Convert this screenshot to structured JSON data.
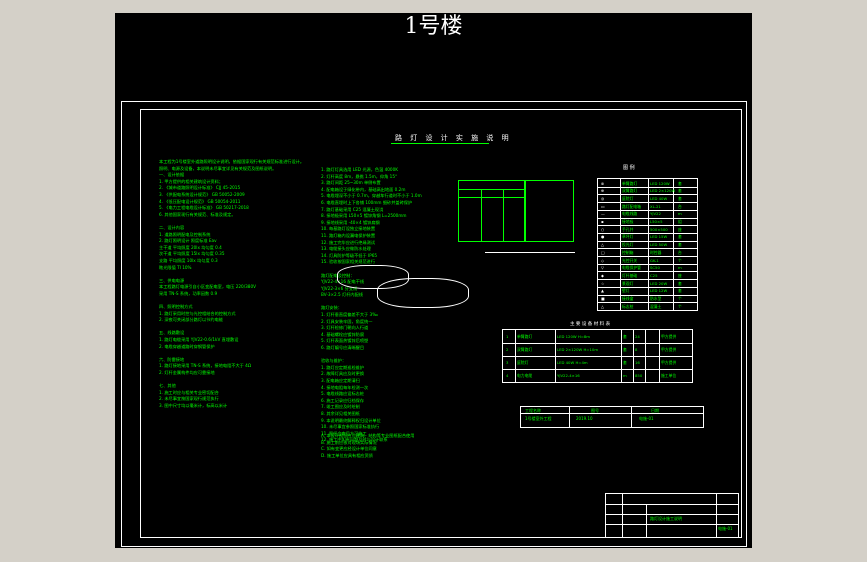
{
  "page_title": "1号楼",
  "heading": "路 灯 设 计 实 施 说 明",
  "col1_lines": [
    "本工程为1号楼室外道路照明设计说明，依据国家现行有关规范标准进行设计。",
    "照明、电源及设备，本说明未尽事宜详见有关规范及图纸说明。",
    "一、设计依据",
    "1. 甲方提供的相关建筑设计资料；",
    "2. 《城市道路照明设计标准》 CJJ 45-2015",
    "3. 《供配电系统设计规范》 GB 50052-2009",
    "4. 《低压配电设计规范》 GB 50054-2011",
    "5. 《电力工程电缆设计标准》 GB 50217-2018",
    "6. 其他国家现行有关规范、标准及规定。",
    "",
    "二、设计内容",
    "1. 道路照明配电及控制系统",
    "2. 路灯照明设计  照度标准  Eav",
    "   主干道 平均照度 20lx  均匀度 0.4",
    "   次干道 平均照度 15lx  均匀度 0.35",
    "   支路   平均照度 10lx  均匀度 0.3",
    "   眩光限值  TI  10%",
    "",
    "三、供电电源",
    "   本工程路灯电源引自小区变配电室，电压 220/380V",
    "   采用 TN-S 系统，功率因数 0.9",
    "",
    "四、照明控制方式",
    "   1. 路灯采用时控与光控相结合的控制方式",
    "   2. 深夜可关闭部分路灯以节约电能",
    "",
    "五、线路敷设",
    "   1. 路灯电缆采用 YJV22-0.6/1kV 直埋敷设",
    "   2. 电缆穿越道路时穿钢管保护",
    "",
    "六、防雷接地",
    "   1. 路灯接地采用 TN-S 系统，接地电阻不大于 4Ω",
    "   2. 灯杆金属构件均应可靠接地",
    "",
    "七、其他",
    "   1. 施工时应与相关专业密切配合",
    "   2. 未尽事宜按国家现行规范执行",
    "   3. 图中尺寸均以毫米计，标高以米计"
  ],
  "col2_lines": [
    "1. 路灯灯具选用 LED 光源，色温 4000K",
    "2. 灯杆高度 8m，悬挑 1.5m，仰角 15°",
    "3. 路灯间距 25~30m 单侧布置",
    "4. 配电箱设于绿化带内，基础高出地面 0.2m",
    "5. 电缆埋深不小于 0.7m，穿越车行道时不小于 1.0m",
    "6. 电缆直埋时上下各铺 100mm 细砂并盖砖保护",
    "7. 路灯基础采用 C25 混凝土现浇",
    "8. 接地极采用 L50×5 镀锌角钢 L=2500mm",
    "9. 接地线采用 -40×4 镀锌扁钢",
    "10. 每基路灯设独立接地装置",
    "11. 路灯箱内设漏电保护装置",
    "12. 施工完毕应进行绝缘测试",
    "13. 电缆接头应做防水处理",
    "14. 灯具防护等级不低于 IP65",
    "15. 验收按国家相关规范进行",
    "",
    "路灯配电及控制：",
    "  YJV22-4×16 配电干线",
    "  YJV22-3×6 分支线",
    "  BV-3×2.5 灯杆内配线",
    "",
    "路灯安装：",
    "  1. 灯杆垂直度偏差不大于 3‰",
    "  2. 灯具安装牢固，角度统一",
    "  3. 灯杆检修门朝向人行道",
    "  4. 基础螺栓应镀锌防腐",
    "  5. 灯杆表面热镀锌后喷塑",
    "  6. 路灯编号应清晰醒目",
    "",
    "验收与维护：",
    "  1. 路灯应定期巡检维护",
    "  2. 故障灯具应及时更换",
    "  3. 配电箱应定期清扫",
    "  4. 接地电阻每年检测一次",
    "  5. 电缆线路应设标志桩",
    "  6. 施工记录应归档保存",
    "  7. 竣工图应及时绘制",
    "  8. 其余详见相关图纸",
    "  9. 本说明最终解释权归设计单位",
    "  10. 未尽事宜参照国家标准执行",
    "  11. 图纸会审后方可施工",
    "  12. 施工中如有问题及时与设计联系"
  ],
  "col2_short_lines": [
    "A. 本设计图纸应与建筑、结构等专业图纸配合使用",
    "B. 施工前应核对现场实际情况",
    "C. 如有变更应经设计单位同意",
    "D. 施工单位应具有相应资质"
  ],
  "legend_title": "图 例",
  "legend_rows": [
    [
      "⊗",
      "单臂路灯",
      "LED 120W",
      "套"
    ],
    [
      "⊕",
      "双臂路灯",
      "LED 2×120W",
      "套"
    ],
    [
      "◎",
      "庭院灯",
      "LED 40W",
      "套"
    ],
    [
      "▭",
      "路灯配电箱",
      "XL-21",
      "台"
    ],
    [
      "—",
      "电缆线路",
      "YJV22",
      "m"
    ],
    [
      "▪",
      "接地极",
      "L50×5",
      "组"
    ],
    [
      "○",
      "手孔井",
      "500×500",
      "座"
    ],
    [
      "●",
      "草坪灯",
      "LED 15W",
      "套"
    ],
    [
      "△",
      "投光灯",
      "LED 50W",
      "套"
    ],
    [
      "□",
      "控制箱",
      "时控器",
      "台"
    ],
    [
      "◇",
      "光控开关",
      "GK-1",
      "个"
    ],
    [
      "▽",
      "电缆保护管",
      "SC50",
      "m"
    ],
    [
      "◆",
      "灯杆基础",
      "C25",
      "座"
    ],
    [
      "☆",
      "景观灯",
      "LED 20W",
      "套"
    ],
    [
      "▲",
      "壁灯",
      "LED 12W",
      "套"
    ],
    [
      "■",
      "接线盒",
      "防水型",
      "个"
    ],
    [
      "△",
      "标志桩",
      "混凝土",
      "个"
    ]
  ],
  "main_table_title": "主 要 设 备 材 料 表",
  "main_table_rows": [
    [
      "1",
      "单臂路灯",
      "LED 120W H=8m",
      "套",
      "24",
      "甲方提供"
    ],
    [
      "2",
      "双臂路灯",
      "LED 2×120W H=10m",
      "套",
      "8",
      "甲方提供"
    ],
    [
      "3",
      "庭院灯",
      "LED 40W H=4m",
      "套",
      "16",
      "甲方提供"
    ],
    [
      "4",
      "电力电缆",
      "YJV22-4×16",
      "m",
      "850",
      "施工单位"
    ]
  ],
  "sign_table": {
    "h1": "工程名称",
    "h2": "图号",
    "h3": "日期",
    "r1": "1号楼室外工程",
    "r2": "2019.10",
    "r3": "电施-01"
  },
  "title_block": {
    "drawing_name": "路灯设计施工说明",
    "sheet": "电施-01"
  }
}
